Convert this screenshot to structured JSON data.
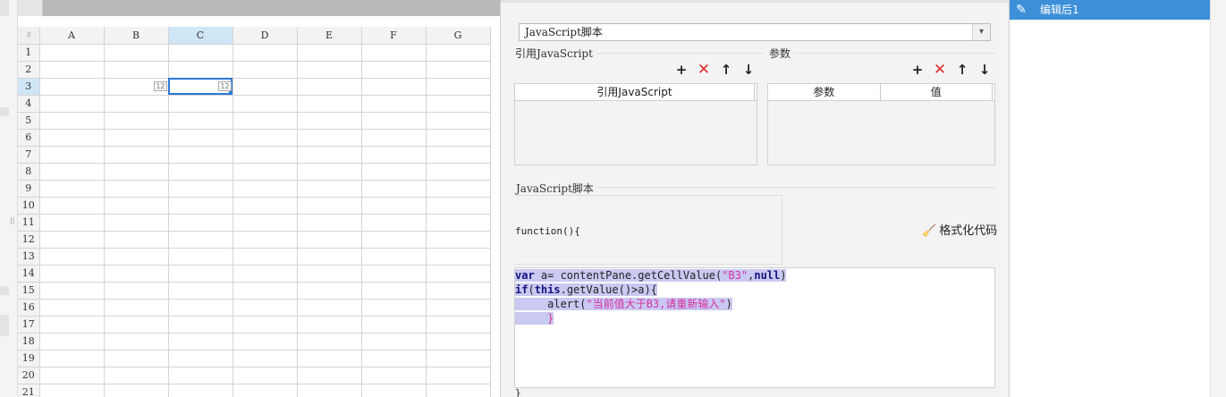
{
  "spreadsheet": {
    "columns": [
      "A",
      "B",
      "C",
      "D",
      "E",
      "F",
      "G"
    ],
    "rows": [
      "1",
      "2",
      "3",
      "4",
      "5",
      "6",
      "7",
      "8",
      "9",
      "10",
      "11",
      "12",
      "13",
      "14",
      "15",
      "16",
      "17",
      "18",
      "19",
      "20",
      "21"
    ],
    "selected_column": "C",
    "selected_row": "3",
    "corner_glyph": "⠿",
    "cell_b3_tag": "12",
    "cell_c3_tag": "12"
  },
  "panel": {
    "script_type": "JavaScript脚本",
    "dropdown_arrow": "▾",
    "ref_js_title": "引用JavaScript",
    "params_title": "参数",
    "ref_js_column": "引用JavaScript",
    "param_col_name": "参数",
    "param_col_value": "值",
    "icons": {
      "add": "+",
      "delete": "✕",
      "up": "↑",
      "down": "↓"
    },
    "script_section_title": "JavaScript脚本",
    "function_header": "function(){",
    "format_button": "格式化代码",
    "function_footer": "}"
  },
  "code": {
    "line1_kw": "var",
    "line1_mid": " a= contentPane.getCellValue(",
    "line1_str": "\"B3\"",
    "line1_comma": ",",
    "line1_null": "null",
    "line1_end": ")",
    "line2_kw1": "if",
    "line2_mid1": "(",
    "line2_kw2": "this",
    "line2_mid2": ".getValue()>a){",
    "line3_pre": "     alert(",
    "line3_str": "\"当前值大于B3,请重新输入\"",
    "line3_end": ")",
    "line4": "     }"
  },
  "events": {
    "item_label": "编辑后1",
    "item_icon": "pencil-icon"
  }
}
